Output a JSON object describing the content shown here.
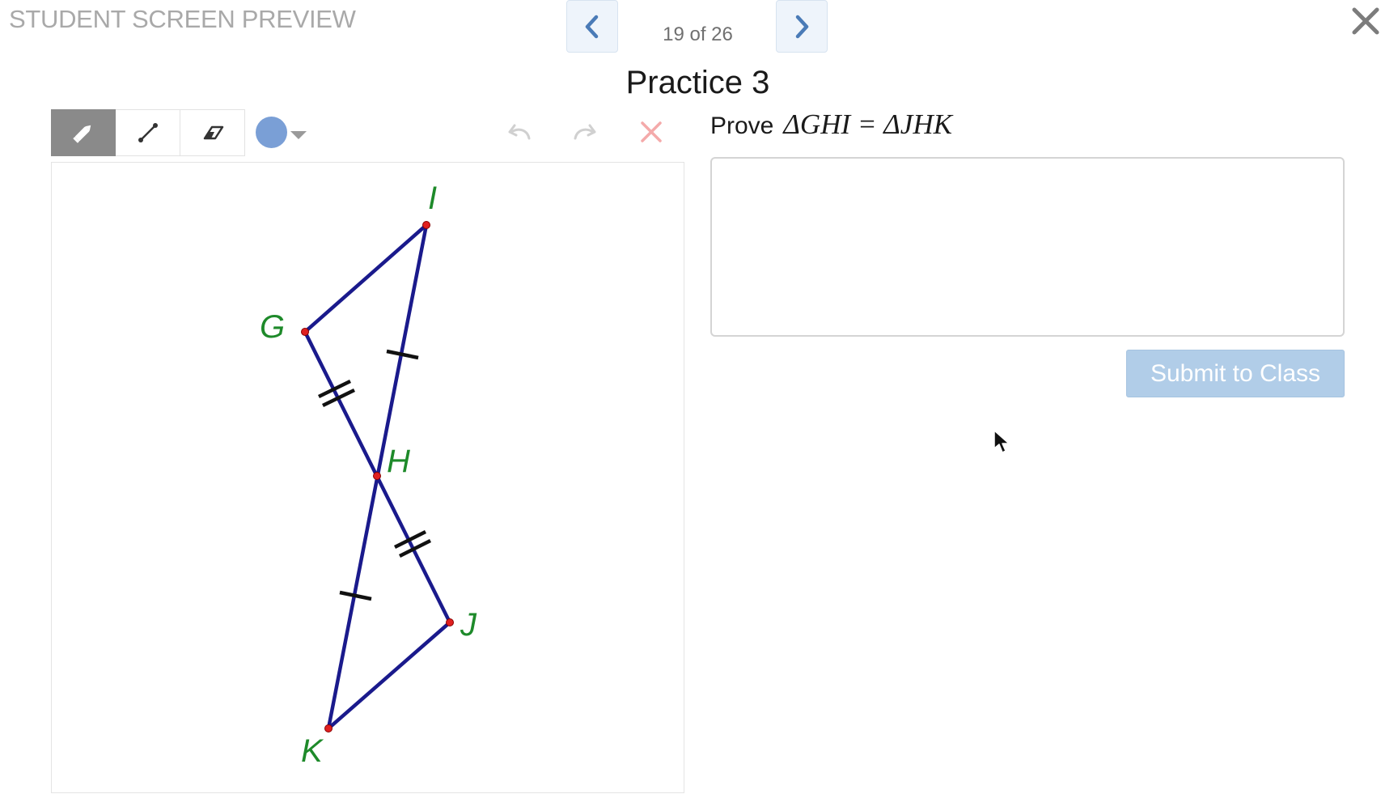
{
  "header": {
    "preview_label": "STUDENT SCREEN PREVIEW",
    "page_counter": "19 of 26",
    "prev_icon": "chevron-left-icon",
    "next_icon": "chevron-right-icon",
    "close_icon": "close-icon"
  },
  "page_title": "Practice 3",
  "toolbar": {
    "tools": [
      {
        "name": "pencil",
        "icon": "pencil-icon",
        "active": true
      },
      {
        "name": "line",
        "icon": "line-segment-icon",
        "active": false
      },
      {
        "name": "eraser",
        "icon": "eraser-icon",
        "active": false
      }
    ],
    "color": "#7a9fd6",
    "undo_icon": "undo-icon",
    "redo_icon": "redo-icon",
    "clear_icon": "clear-icon"
  },
  "figure": {
    "points": [
      {
        "name": "I",
        "label": "I"
      },
      {
        "name": "G",
        "label": "G"
      },
      {
        "name": "H",
        "label": "H"
      },
      {
        "name": "J",
        "label": "J"
      },
      {
        "name": "K",
        "label": "K"
      }
    ],
    "line_color": "#1a1a8c",
    "point_color": "#e02020",
    "label_color": "#1e8a2a"
  },
  "question": {
    "prompt_word": "Prove",
    "statement": "ΔGHI = ΔJHK"
  },
  "answer": {
    "value": ""
  },
  "submit": {
    "label": "Submit to Class"
  }
}
